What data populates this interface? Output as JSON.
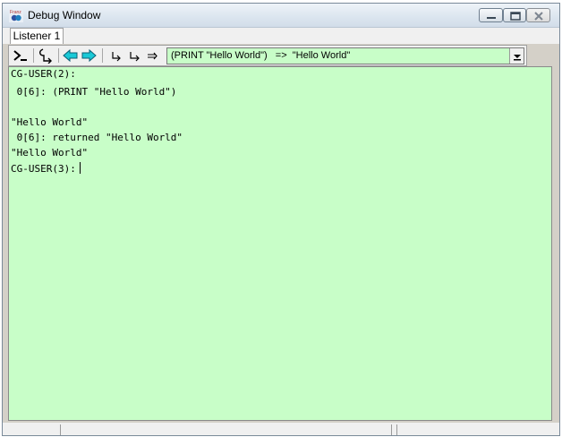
{
  "window": {
    "title": "Debug Window",
    "icon": "franz-lisp-app-icon"
  },
  "title_buttons": [
    "minimize-icon",
    "maximize-icon",
    "close-icon"
  ],
  "tabs": [
    {
      "label": "Listener 1",
      "active": true
    }
  ],
  "toolbar": {
    "buttons": [
      "prompt-icon",
      "step-into-icon",
      "back-arrow-icon",
      "forward-arrow-icon",
      "step-over-icon",
      "step-out-icon",
      "return-icon"
    ],
    "expression": "(PRINT \"Hello World\")   =>  \"Hello World\""
  },
  "listener": {
    "lines": [
      "CG-USER(2):",
      " 0[6]: (PRINT \"Hello World\")",
      "",
      "\"Hello World\"",
      " 0[6]: returned \"Hello World\"",
      "\"Hello World\"",
      "CG-USER(3):"
    ]
  },
  "colors": {
    "listener_bg": "#c8fec8",
    "arrow_cyan": "#19c9d6"
  }
}
